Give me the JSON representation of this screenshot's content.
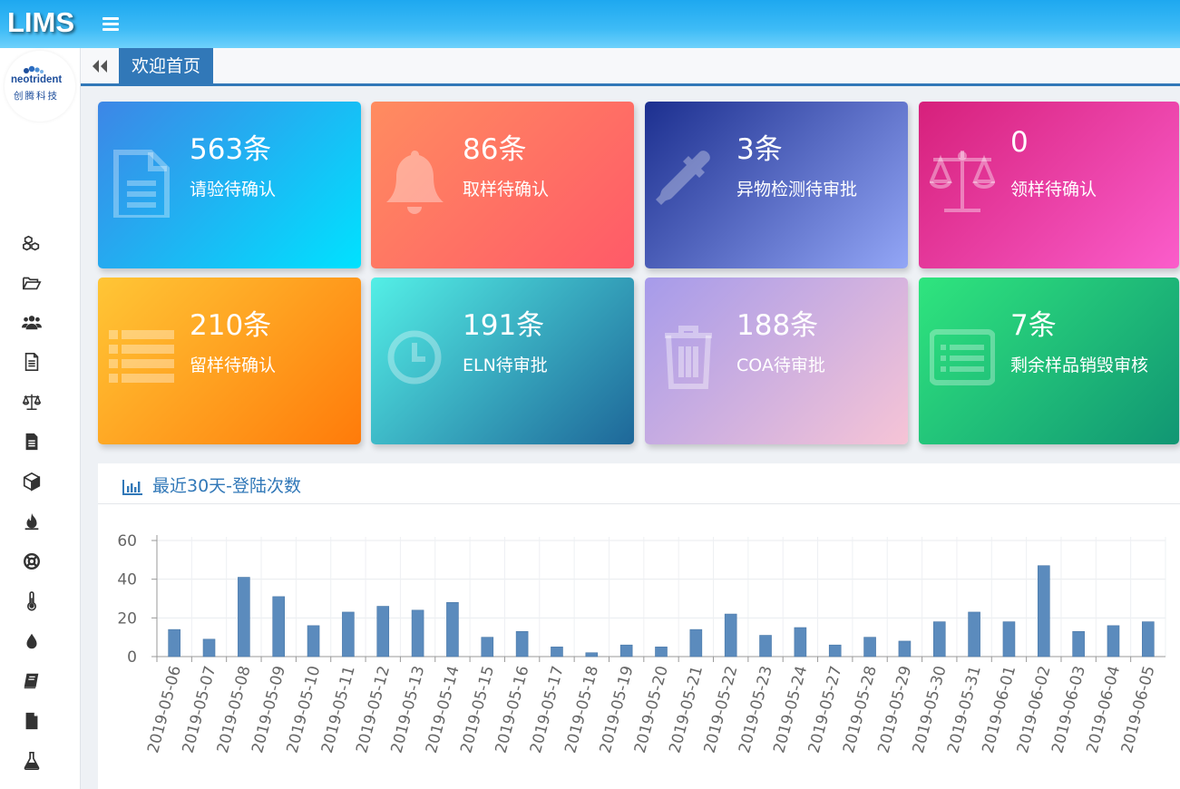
{
  "app": {
    "logo_text": "LIMS"
  },
  "brand": {
    "name": "neotrident",
    "name_cn": "创腾科技"
  },
  "tabs": {
    "home_label": "欢迎首页"
  },
  "sidebar": {
    "icons": [
      "cubes-icon",
      "folder-open-icon",
      "users-icon",
      "document-icon",
      "balance-scale-icon",
      "file-text-icon",
      "cube-icon",
      "flame-icon",
      "life-ring-icon",
      "thermometer-icon",
      "drop-icon",
      "book-icon",
      "file-icon",
      "flask-icon"
    ]
  },
  "cards": [
    {
      "count": "563条",
      "label": "请验待确认",
      "icon": "document-icon",
      "gradient": [
        "#3d86e6",
        "#00e2ff"
      ]
    },
    {
      "count": "86条",
      "label": "取样待确认",
      "icon": "bell-icon",
      "gradient": [
        "#ff8c60",
        "#ff5a68"
      ]
    },
    {
      "count": "3条",
      "label": "异物检测待审批",
      "icon": "eyedropper-icon",
      "gradient": [
        "#1c2f8f",
        "#93a6f6"
      ]
    },
    {
      "count": "0",
      "label": "领样待确认",
      "icon": "balance-scale-icon",
      "gradient": [
        "#d6207b",
        "#fb5dcb"
      ]
    },
    {
      "count": "210条",
      "label": "留样待确认",
      "icon": "list-icon",
      "gradient": [
        "#ffc636",
        "#ff7b0a"
      ]
    },
    {
      "count": "191条",
      "label": "ELN待审批",
      "icon": "clock-icon",
      "gradient": [
        "#53efe6",
        "#1e6799"
      ]
    },
    {
      "count": "188条",
      "label": "COA待审批",
      "icon": "trash-icon",
      "gradient": [
        "#a69bea",
        "#f6c4d6"
      ]
    },
    {
      "count": "7条",
      "label": "剩余样品销毁审核",
      "icon": "list-alt-icon",
      "gradient": [
        "#2fe57e",
        "#119673"
      ]
    }
  ],
  "chart_panel": {
    "title": "最近30天-登陆次数",
    "icon": "bar-chart-icon"
  },
  "chart_data": {
    "type": "bar",
    "title": "最近30天-登陆次数",
    "categories": [
      "2019-05-06",
      "2019-05-07",
      "2019-05-08",
      "2019-05-09",
      "2019-05-10",
      "2019-05-11",
      "2019-05-12",
      "2019-05-13",
      "2019-05-14",
      "2019-05-15",
      "2019-05-16",
      "2019-05-17",
      "2019-05-18",
      "2019-05-19",
      "2019-05-20",
      "2019-05-21",
      "2019-05-22",
      "2019-05-23",
      "2019-05-24",
      "2019-05-27",
      "2019-05-28",
      "2019-05-29",
      "2019-05-30",
      "2019-05-31",
      "2019-06-01",
      "2019-06-02",
      "2019-06-03",
      "2019-06-04",
      "2019-06-05"
    ],
    "values": [
      14,
      9,
      41,
      31,
      16,
      23,
      26,
      24,
      28,
      10,
      13,
      5,
      2,
      6,
      5,
      14,
      22,
      11,
      15,
      6,
      10,
      8,
      18,
      23,
      18,
      47,
      13,
      16,
      18
    ],
    "ylim": [
      0,
      60
    ],
    "yticks": [
      0,
      20,
      40,
      60
    ],
    "grid": true,
    "bar_color": "#5b8bbd"
  }
}
